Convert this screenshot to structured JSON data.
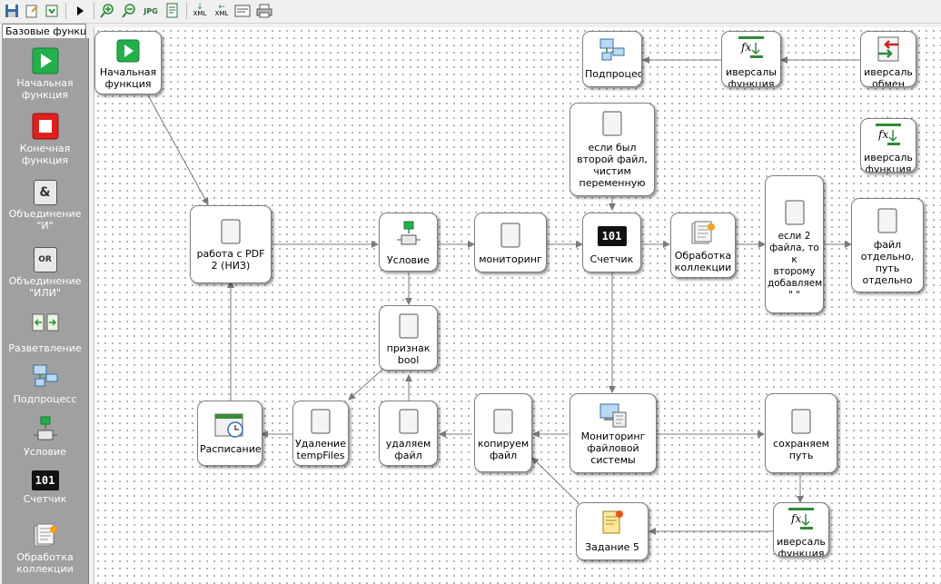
{
  "toolbar": {
    "buttons": [
      "save-icon",
      "open-icon",
      "export-icon",
      "run-icon",
      "zoom-in-icon",
      "zoom-out-icon",
      "jpg-icon",
      "document-icon",
      "xml-export-icon",
      "xml-import-icon",
      "properties-icon",
      "print-icon"
    ],
    "jpg_label": "JPG",
    "xml_label": "XML"
  },
  "palette": {
    "tab_label": "Базовые функц...",
    "items": [
      {
        "label": "Начальная\nфункция",
        "icon": "start-function-icon"
      },
      {
        "label": "Конечная\nфункция",
        "icon": "end-function-icon"
      },
      {
        "label": "Объединение\n\"И\"",
        "icon": "and-join-icon",
        "glyph": "&"
      },
      {
        "label": "Объединение\n\"ИЛИ\"",
        "icon": "or-join-icon",
        "glyph": "OR"
      },
      {
        "label": "Разветвление",
        "icon": "branch-icon"
      },
      {
        "label": "Подпроцесс",
        "icon": "subprocess-icon"
      },
      {
        "label": "Условие",
        "icon": "condition-icon"
      },
      {
        "label": "Счетчик",
        "icon": "counter-icon",
        "glyph": "101"
      },
      {
        "label": "Обработка\nколлекции",
        "icon": "collection-icon"
      }
    ]
  },
  "nodes": {
    "start": {
      "label": "Начальная\nфункция",
      "icon": "start-function-icon"
    },
    "pdf": {
      "label": "работа с PDF\n2 (НИЗ)",
      "icon": "function-icon"
    },
    "cond": {
      "label": "Условие",
      "icon": "condition-icon"
    },
    "monitor": {
      "label": "мониторинг",
      "icon": "function-icon"
    },
    "counter": {
      "label": "Счетчик",
      "icon": "counter-icon",
      "glyph": "101"
    },
    "collection": {
      "label": "Обработка\nколлекции",
      "icon": "collection-icon"
    },
    "if2": {
      "label": "если 2\nфайла, то\nк\nвторому\nдобавляем\n\" \"",
      "icon": "function-icon"
    },
    "separate": {
      "label": "файл\nотдельно,\nпуть\nотдельно",
      "icon": "function-icon"
    },
    "subproc": {
      "label": "Подпроцес",
      "icon": "subprocess-icon"
    },
    "univ1": {
      "label": "иверсалы\nфункция",
      "icon": "fx-icon"
    },
    "univexch": {
      "label": "иверсаль\nобмен",
      "icon": "exchange-icon"
    },
    "univ2": {
      "label": "иверсаль\nфункция",
      "icon": "fx-icon"
    },
    "ifsecond": {
      "label": "если был\nвторой файл,\nчистим\nпеременную",
      "icon": "function-icon"
    },
    "flagbool": {
      "label": "признак\nbool",
      "icon": "function-icon"
    },
    "schedule": {
      "label": "Расписание",
      "icon": "schedule-icon"
    },
    "deltemp": {
      "label": "Удаление\ntempFiles",
      "icon": "function-icon"
    },
    "delfile": {
      "label": "удаляем\nфайл",
      "icon": "function-icon"
    },
    "copyfile": {
      "label": "копируем\nфайл",
      "icon": "function-icon"
    },
    "fsmon": {
      "label": "Мониторинг\nфайловой\nсистемы",
      "icon": "filesystem-monitor-icon"
    },
    "savepath": {
      "label": "сохраняем\nпуть",
      "icon": "function-icon"
    },
    "task5": {
      "label": "Задание 5",
      "icon": "task-icon"
    },
    "univ3": {
      "label": "иверсаль\nфункция",
      "icon": "fx-icon"
    }
  },
  "colors": {
    "canvas": "#ffffff",
    "palette_bg": "#a0a0a0",
    "start_green": "#22b04a",
    "end_red": "#e02020",
    "wire": "#7a7a7a"
  }
}
